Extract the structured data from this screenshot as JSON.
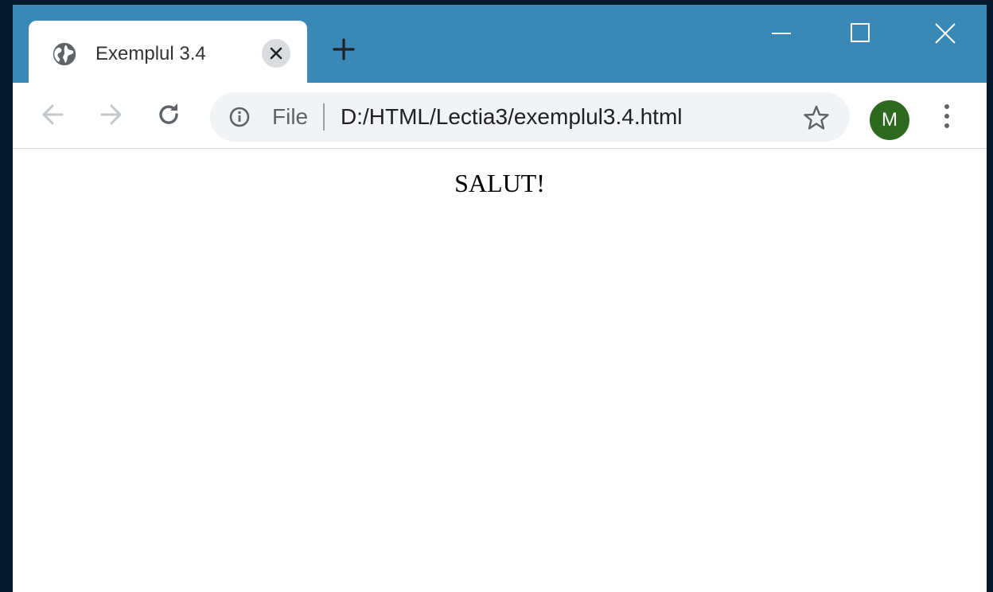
{
  "tab": {
    "title": "Exemplul 3.4",
    "favicon": "globe-icon"
  },
  "window_controls": [
    "minimize-icon",
    "maximize-icon",
    "close-icon"
  ],
  "toolbar": {
    "icons": [
      "back-arrow-icon",
      "forward-arrow-icon",
      "reload-icon"
    ],
    "omnibox": {
      "security_icon": "info-icon",
      "scheme_label": "File",
      "url": "D:/HTML/Lectia3/exemplul3.4.html",
      "bookmark_icon": "star-icon"
    },
    "profile_initial": "M",
    "menu_icon": "vertical-dots-icon"
  },
  "page": {
    "text": "SALUT!"
  },
  "colors": {
    "titlebar": "#3a88b5",
    "avatar": "#2d6a1f",
    "desktop": "#041a2c"
  }
}
